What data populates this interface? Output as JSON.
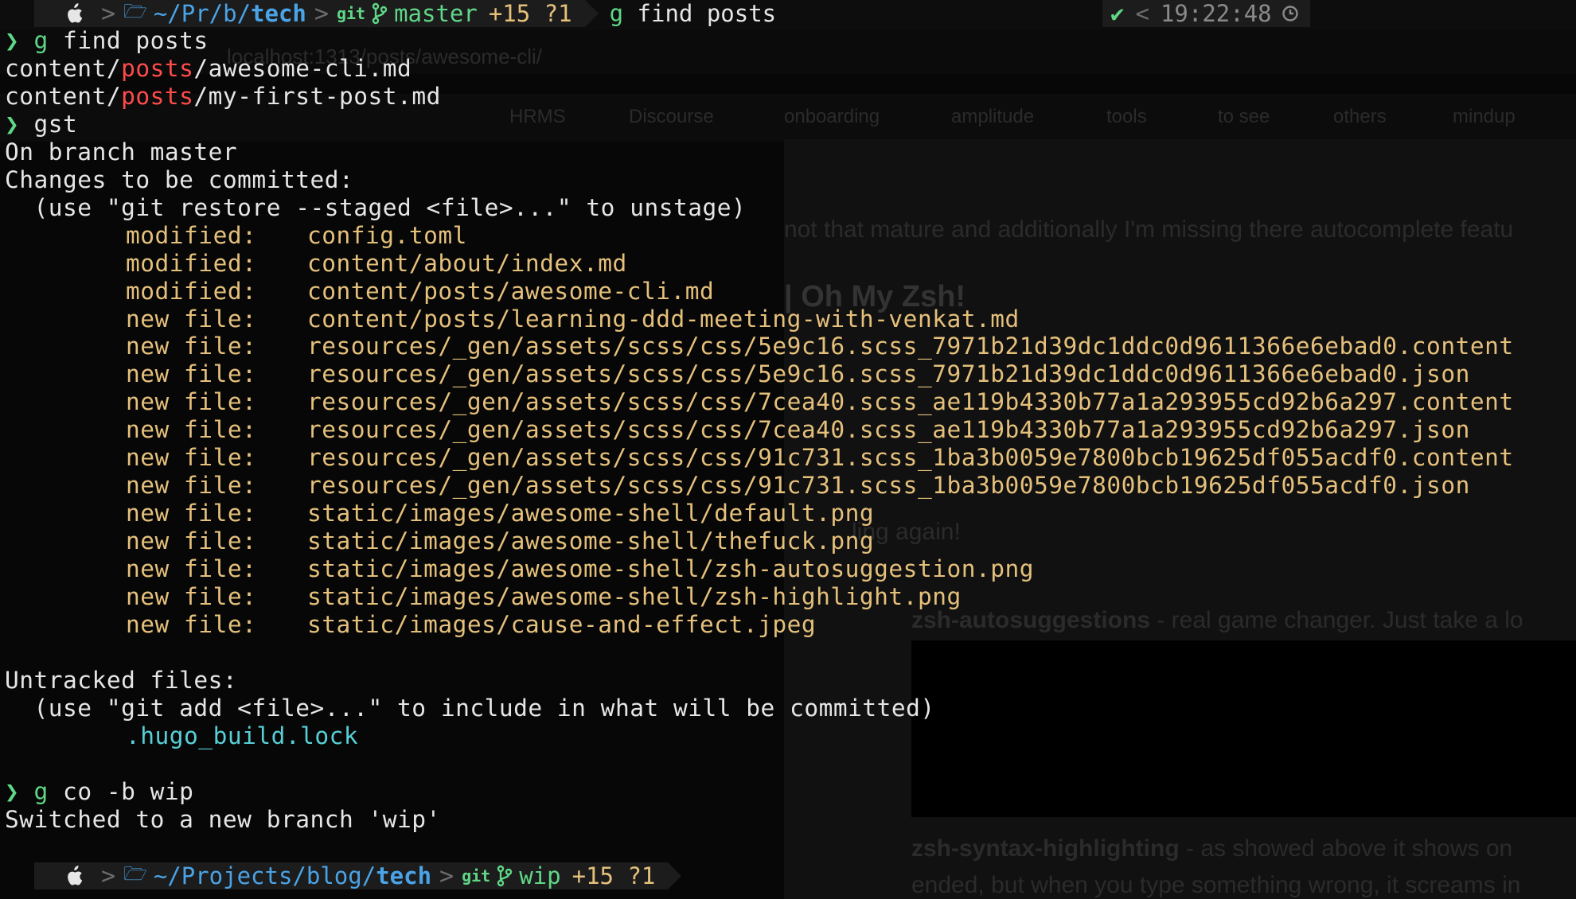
{
  "top_prompt": {
    "path_prefix": "~/Pr/b/",
    "path_dir": "tech",
    "git_label": "git",
    "branch": "master",
    "status": "+15 ?1",
    "typed_command_g": "g",
    "typed_command_rest": " find posts",
    "check": "✔",
    "time": "19:22:48"
  },
  "lines": [
    {
      "kind": "cmd",
      "g": "g",
      "rest": " find posts"
    },
    {
      "kind": "find",
      "pre": "content/",
      "hl": "posts",
      "post": "/awesome-cli.md"
    },
    {
      "kind": "find",
      "pre": "content/",
      "hl": "posts",
      "post": "/my-first-post.md"
    },
    {
      "kind": "cmd",
      "g": "",
      "rest": "gst"
    },
    {
      "kind": "out",
      "text": "On branch master"
    },
    {
      "kind": "out",
      "text": "Changes to be committed:"
    },
    {
      "kind": "out",
      "text": "  (use \"git restore --staged <file>...\" to unstage)"
    },
    {
      "kind": "change",
      "status": "modified:",
      "file": "config.toml"
    },
    {
      "kind": "change",
      "status": "modified:",
      "file": "content/about/index.md"
    },
    {
      "kind": "change",
      "status": "modified:",
      "file": "content/posts/awesome-cli.md"
    },
    {
      "kind": "change",
      "status": "new file:",
      "file": "content/posts/learning-ddd-meeting-with-venkat.md"
    },
    {
      "kind": "change",
      "status": "new file:",
      "file": "resources/_gen/assets/scss/css/5e9c16.scss_7971b21d39dc1ddc0d9611366e6ebad0.content"
    },
    {
      "kind": "change",
      "status": "new file:",
      "file": "resources/_gen/assets/scss/css/5e9c16.scss_7971b21d39dc1ddc0d9611366e6ebad0.json"
    },
    {
      "kind": "change",
      "status": "new file:",
      "file": "resources/_gen/assets/scss/css/7cea40.scss_ae119b4330b77a1a293955cd92b6a297.content"
    },
    {
      "kind": "change",
      "status": "new file:",
      "file": "resources/_gen/assets/scss/css/7cea40.scss_ae119b4330b77a1a293955cd92b6a297.json"
    },
    {
      "kind": "change",
      "status": "new file:",
      "file": "resources/_gen/assets/scss/css/91c731.scss_1ba3b0059e7800bcb19625df055acdf0.content"
    },
    {
      "kind": "change",
      "status": "new file:",
      "file": "resources/_gen/assets/scss/css/91c731.scss_1ba3b0059e7800bcb19625df055acdf0.json"
    },
    {
      "kind": "change",
      "status": "new file:",
      "file": "static/images/awesome-shell/default.png"
    },
    {
      "kind": "change",
      "status": "new file:",
      "file": "static/images/awesome-shell/thefuck.png"
    },
    {
      "kind": "change",
      "status": "new file:",
      "file": "static/images/awesome-shell/zsh-autosuggestion.png"
    },
    {
      "kind": "change",
      "status": "new file:",
      "file": "static/images/awesome-shell/zsh-highlight.png"
    },
    {
      "kind": "change",
      "status": "new file:",
      "file": "static/images/cause-and-effect.jpeg"
    },
    {
      "kind": "blank"
    },
    {
      "kind": "out",
      "text": "Untracked files:"
    },
    {
      "kind": "out",
      "text": "  (use \"git add <file>...\" to include in what will be committed)"
    },
    {
      "kind": "untracked",
      "file": ".hugo_build.lock"
    },
    {
      "kind": "blank"
    },
    {
      "kind": "cmd",
      "g": "g",
      "rest": " co -b wip"
    },
    {
      "kind": "out",
      "text": "Switched to a new branch 'wip'"
    }
  ],
  "bottom_prompt": {
    "path_prefix": "~/Projects/blog/",
    "path_dir": "tech",
    "git_label": "git",
    "branch": "wip",
    "status": "+15 ?1"
  },
  "background_page": {
    "url": "localhost:1313/posts/awesome-cli/",
    "bookmarks": [
      "HRMS",
      "Discourse",
      "onboarding",
      "amplitude",
      "tools",
      "to see",
      "others",
      "mindup"
    ],
    "heading": "| Oh My Zsh!",
    "text_1": "not that mature and additionally I'm missing there autocomplete featu",
    "text_2": "ling again!",
    "bullet_1_title": "zsh-autosuggestions",
    "bullet_1_rest": " - real game changer. Just take a lo",
    "bullet_2_title": "zsh-syntax-highlighting",
    "bullet_2_rest": " - as showed above it shows on",
    "bullet_2_line2": "ended, but when you type something wrong, it screams in"
  }
}
